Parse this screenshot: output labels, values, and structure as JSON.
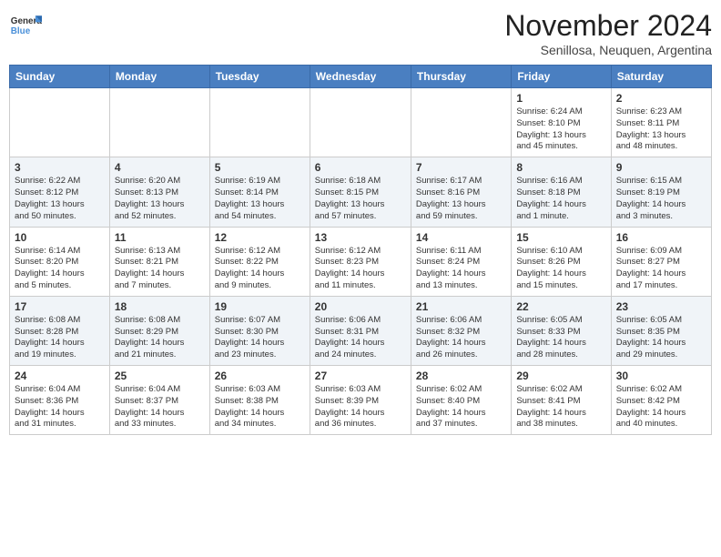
{
  "header": {
    "logo_general": "General",
    "logo_blue": "Blue",
    "month_year": "November 2024",
    "location": "Senillosa, Neuquen, Argentina"
  },
  "days_of_week": [
    "Sunday",
    "Monday",
    "Tuesday",
    "Wednesday",
    "Thursday",
    "Friday",
    "Saturday"
  ],
  "weeks": [
    [
      {
        "day": "",
        "info": ""
      },
      {
        "day": "",
        "info": ""
      },
      {
        "day": "",
        "info": ""
      },
      {
        "day": "",
        "info": ""
      },
      {
        "day": "",
        "info": ""
      },
      {
        "day": "1",
        "info": "Sunrise: 6:24 AM\nSunset: 8:10 PM\nDaylight: 13 hours\nand 45 minutes."
      },
      {
        "day": "2",
        "info": "Sunrise: 6:23 AM\nSunset: 8:11 PM\nDaylight: 13 hours\nand 48 minutes."
      }
    ],
    [
      {
        "day": "3",
        "info": "Sunrise: 6:22 AM\nSunset: 8:12 PM\nDaylight: 13 hours\nand 50 minutes."
      },
      {
        "day": "4",
        "info": "Sunrise: 6:20 AM\nSunset: 8:13 PM\nDaylight: 13 hours\nand 52 minutes."
      },
      {
        "day": "5",
        "info": "Sunrise: 6:19 AM\nSunset: 8:14 PM\nDaylight: 13 hours\nand 54 minutes."
      },
      {
        "day": "6",
        "info": "Sunrise: 6:18 AM\nSunset: 8:15 PM\nDaylight: 13 hours\nand 57 minutes."
      },
      {
        "day": "7",
        "info": "Sunrise: 6:17 AM\nSunset: 8:16 PM\nDaylight: 13 hours\nand 59 minutes."
      },
      {
        "day": "8",
        "info": "Sunrise: 6:16 AM\nSunset: 8:18 PM\nDaylight: 14 hours\nand 1 minute."
      },
      {
        "day": "9",
        "info": "Sunrise: 6:15 AM\nSunset: 8:19 PM\nDaylight: 14 hours\nand 3 minutes."
      }
    ],
    [
      {
        "day": "10",
        "info": "Sunrise: 6:14 AM\nSunset: 8:20 PM\nDaylight: 14 hours\nand 5 minutes."
      },
      {
        "day": "11",
        "info": "Sunrise: 6:13 AM\nSunset: 8:21 PM\nDaylight: 14 hours\nand 7 minutes."
      },
      {
        "day": "12",
        "info": "Sunrise: 6:12 AM\nSunset: 8:22 PM\nDaylight: 14 hours\nand 9 minutes."
      },
      {
        "day": "13",
        "info": "Sunrise: 6:12 AM\nSunset: 8:23 PM\nDaylight: 14 hours\nand 11 minutes."
      },
      {
        "day": "14",
        "info": "Sunrise: 6:11 AM\nSunset: 8:24 PM\nDaylight: 14 hours\nand 13 minutes."
      },
      {
        "day": "15",
        "info": "Sunrise: 6:10 AM\nSunset: 8:26 PM\nDaylight: 14 hours\nand 15 minutes."
      },
      {
        "day": "16",
        "info": "Sunrise: 6:09 AM\nSunset: 8:27 PM\nDaylight: 14 hours\nand 17 minutes."
      }
    ],
    [
      {
        "day": "17",
        "info": "Sunrise: 6:08 AM\nSunset: 8:28 PM\nDaylight: 14 hours\nand 19 minutes."
      },
      {
        "day": "18",
        "info": "Sunrise: 6:08 AM\nSunset: 8:29 PM\nDaylight: 14 hours\nand 21 minutes."
      },
      {
        "day": "19",
        "info": "Sunrise: 6:07 AM\nSunset: 8:30 PM\nDaylight: 14 hours\nand 23 minutes."
      },
      {
        "day": "20",
        "info": "Sunrise: 6:06 AM\nSunset: 8:31 PM\nDaylight: 14 hours\nand 24 minutes."
      },
      {
        "day": "21",
        "info": "Sunrise: 6:06 AM\nSunset: 8:32 PM\nDaylight: 14 hours\nand 26 minutes."
      },
      {
        "day": "22",
        "info": "Sunrise: 6:05 AM\nSunset: 8:33 PM\nDaylight: 14 hours\nand 28 minutes."
      },
      {
        "day": "23",
        "info": "Sunrise: 6:05 AM\nSunset: 8:35 PM\nDaylight: 14 hours\nand 29 minutes."
      }
    ],
    [
      {
        "day": "24",
        "info": "Sunrise: 6:04 AM\nSunset: 8:36 PM\nDaylight: 14 hours\nand 31 minutes."
      },
      {
        "day": "25",
        "info": "Sunrise: 6:04 AM\nSunset: 8:37 PM\nDaylight: 14 hours\nand 33 minutes."
      },
      {
        "day": "26",
        "info": "Sunrise: 6:03 AM\nSunset: 8:38 PM\nDaylight: 14 hours\nand 34 minutes."
      },
      {
        "day": "27",
        "info": "Sunrise: 6:03 AM\nSunset: 8:39 PM\nDaylight: 14 hours\nand 36 minutes."
      },
      {
        "day": "28",
        "info": "Sunrise: 6:02 AM\nSunset: 8:40 PM\nDaylight: 14 hours\nand 37 minutes."
      },
      {
        "day": "29",
        "info": "Sunrise: 6:02 AM\nSunset: 8:41 PM\nDaylight: 14 hours\nand 38 minutes."
      },
      {
        "day": "30",
        "info": "Sunrise: 6:02 AM\nSunset: 8:42 PM\nDaylight: 14 hours\nand 40 minutes."
      }
    ]
  ]
}
